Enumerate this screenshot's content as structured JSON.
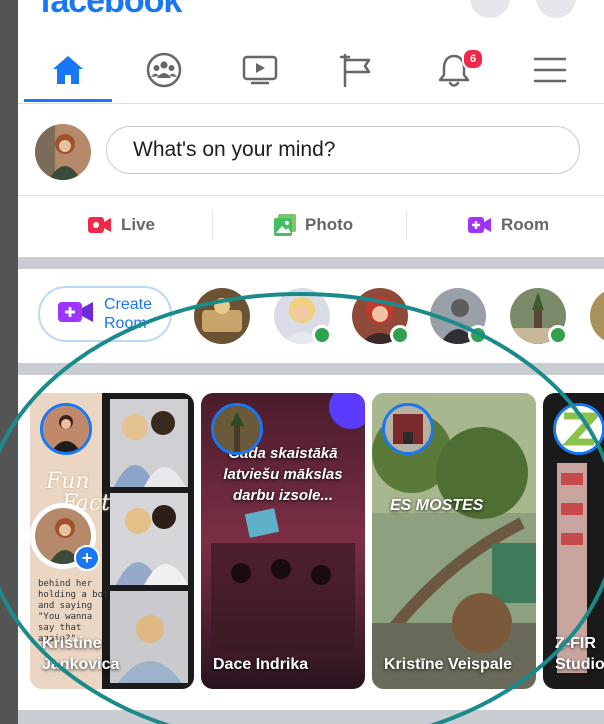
{
  "app": {
    "logo_text": "facebook",
    "brand_color": "#1877f2"
  },
  "nav": {
    "tabs": [
      {
        "name": "home",
        "icon": "home-icon",
        "active": true
      },
      {
        "name": "groups",
        "icon": "groups-icon"
      },
      {
        "name": "watch",
        "icon": "video-icon"
      },
      {
        "name": "pages",
        "icon": "flag-icon"
      },
      {
        "name": "notifications",
        "icon": "bell-icon"
      },
      {
        "name": "menu",
        "icon": "hamburger-menu-icon"
      }
    ],
    "notification_count": "6"
  },
  "composer": {
    "placeholder": "What's on your mind?"
  },
  "actions": {
    "live": "Live",
    "photo": "Photo",
    "room": "Room"
  },
  "rooms": {
    "create_label_line1": "Create",
    "create_label_line2": "Room"
  },
  "stories": [
    {
      "name_line1": "Kristine",
      "name_line2": "Jankovica",
      "overlay_lines": []
    },
    {
      "name_line1": "Dace Indrika",
      "name_line2": "",
      "overlay_lines": [
        "Gada skaistākā",
        "latviešu mākslas",
        "darbu izsole..."
      ]
    },
    {
      "name_line1": "Kristīne Veispale",
      "name_line2": "",
      "overlay_lines": []
    },
    {
      "name_line1": "Z-FIR",
      "name_line2": "Studio",
      "overlay_lines": []
    }
  ],
  "story_photo_caption": [
    "behind her",
    "holding a bot",
    "and saying",
    "\"You wanna",
    "say that",
    "again?\""
  ],
  "story_sticker": {
    "line1": "Fun",
    "line2": "Fact"
  },
  "story_sign": "ES MOSTES",
  "annotation": {
    "color": "#1a8a8a"
  }
}
